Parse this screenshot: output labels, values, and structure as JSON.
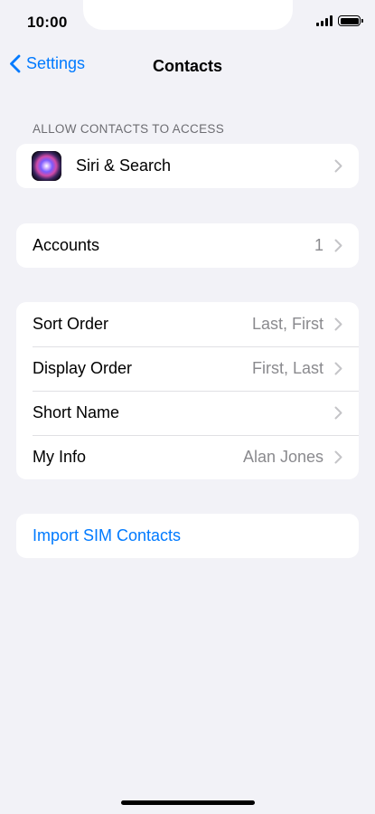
{
  "status_bar": {
    "time": "10:00"
  },
  "nav": {
    "back_label": "Settings",
    "title": "Contacts"
  },
  "sections": {
    "access_header": "ALLOW CONTACTS TO ACCESS",
    "siri": {
      "label": "Siri & Search"
    },
    "accounts": {
      "label": "Accounts",
      "value": "1"
    },
    "settings_rows": [
      {
        "label": "Sort Order",
        "value": "Last, First"
      },
      {
        "label": "Display Order",
        "value": "First, Last"
      },
      {
        "label": "Short Name",
        "value": ""
      },
      {
        "label": "My Info",
        "value": "Alan Jones"
      }
    ],
    "import": {
      "label": "Import SIM Contacts"
    }
  },
  "colors": {
    "accent": "#007aff",
    "background": "#f2f2f7",
    "secondary_text": "#8a8a8e"
  },
  "icons": [
    "signal-icon",
    "battery-icon",
    "back-chevron-icon",
    "siri-icon",
    "chevron-right-icon"
  ]
}
